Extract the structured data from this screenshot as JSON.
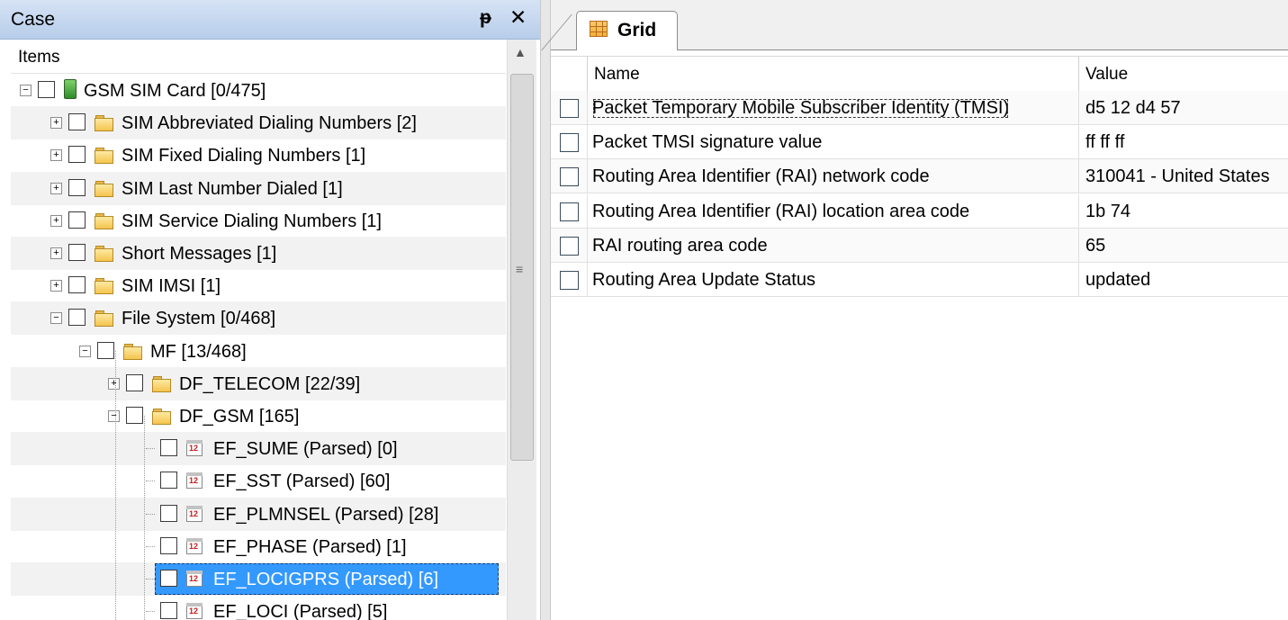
{
  "case_panel": {
    "title": "Case",
    "pin_glyph": "q",
    "close_glyph": "✕",
    "items_header": "Items",
    "tree": [
      {
        "label": "GSM SIM Card [0/475]",
        "icon": "sim-card-icon",
        "expander": "−",
        "level": 0
      },
      {
        "label": "SIM Abbreviated Dialing Numbers [2]",
        "icon": "folder-icon",
        "expander": "+",
        "level": 1
      },
      {
        "label": "SIM Fixed Dialing Numbers [1]",
        "icon": "folder-icon",
        "expander": "+",
        "level": 1
      },
      {
        "label": "SIM Last Number Dialed [1]",
        "icon": "folder-icon",
        "expander": "+",
        "level": 1
      },
      {
        "label": "SIM Service Dialing Numbers [1]",
        "icon": "folder-icon",
        "expander": "+",
        "level": 1
      },
      {
        "label": "Short Messages [1]",
        "icon": "folder-icon",
        "expander": "+",
        "level": 1
      },
      {
        "label": "SIM IMSI [1]",
        "icon": "folder-icon",
        "expander": "+",
        "level": 1
      },
      {
        "label": "File System [0/468]",
        "icon": "folder-icon",
        "expander": "−",
        "level": 1
      },
      {
        "label": "MF [13/468]",
        "icon": "folder-icon",
        "expander": "−",
        "level": 2
      },
      {
        "label": "DF_TELECOM [22/39]",
        "icon": "folder-icon",
        "expander": "+",
        "level": 3
      },
      {
        "label": "DF_GSM [165]",
        "icon": "folder-icon",
        "expander": "−",
        "level": 3
      },
      {
        "label": "EF_SUME (Parsed) [0]",
        "icon": "calendar-icon",
        "level": 4
      },
      {
        "label": "EF_SST (Parsed) [60]",
        "icon": "calendar-icon",
        "level": 4
      },
      {
        "label": "EF_PLMNSEL (Parsed) [28]",
        "icon": "calendar-icon",
        "level": 4
      },
      {
        "label": "EF_PHASE (Parsed) [1]",
        "icon": "calendar-icon",
        "level": 4
      },
      {
        "label": "EF_LOCIGPRS (Parsed) [6]",
        "icon": "calendar-icon",
        "level": 4,
        "selected": true
      },
      {
        "label": "EF_LOCI (Parsed) [5]",
        "icon": "calendar-icon",
        "level": 4
      }
    ]
  },
  "grid_panel": {
    "tab_label": "Grid",
    "tab_icon": "grid-icon",
    "columns": {
      "name": "Name",
      "value": "Value"
    },
    "rows": [
      {
        "name": "Packet Temporary Mobile Subscriber Identity (TMSI)",
        "value": "d5 12 d4 57"
      },
      {
        "name": "Packet TMSI signature value",
        "value": "ff ff ff"
      },
      {
        "name": "Routing Area Identifier (RAI) network code",
        "value": "310041 - United States"
      },
      {
        "name": "Routing Area Identifier (RAI) location area code",
        "value": "1b 74"
      },
      {
        "name": "RAI routing area code",
        "value": "65"
      },
      {
        "name": "Routing Area Update Status",
        "value": "updated"
      }
    ]
  },
  "colors": {
    "header_blue": "#c7d9f0",
    "selection": "#3399ff"
  }
}
